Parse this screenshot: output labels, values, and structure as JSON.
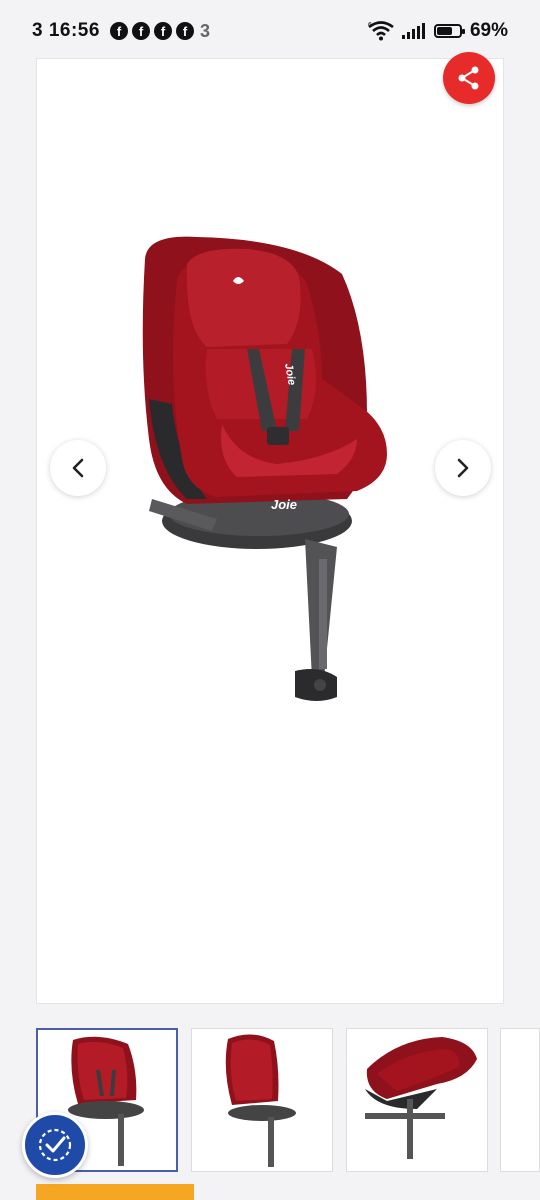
{
  "status_bar": {
    "time": "3 16:56",
    "notification_icons": [
      "facebook-icon",
      "facebook-icon",
      "facebook-icon",
      "facebook-icon",
      "three-network-icon"
    ],
    "fb_glyph": "f",
    "three_glyph": "3",
    "network": "6",
    "battery_percent": "69%",
    "battery_level": 0.69
  },
  "gallery": {
    "brand_text": "Joie",
    "share_icon": "share-icon",
    "prev_icon": "chevron-left-icon",
    "next_icon": "chevron-right-icon",
    "seat_color": "#a3141f",
    "thumbnails": [
      {
        "label": "",
        "selected": true
      },
      {
        "label": "",
        "selected": false
      },
      {
        "label": "",
        "selected": false
      },
      {
        "label": "",
        "selected": false
      }
    ]
  },
  "accessibility": {
    "icon": "accessibility-check-icon"
  },
  "colors": {
    "share": "#e72b2b",
    "accent": "#1f4aa8",
    "banner": "#f5a623"
  }
}
